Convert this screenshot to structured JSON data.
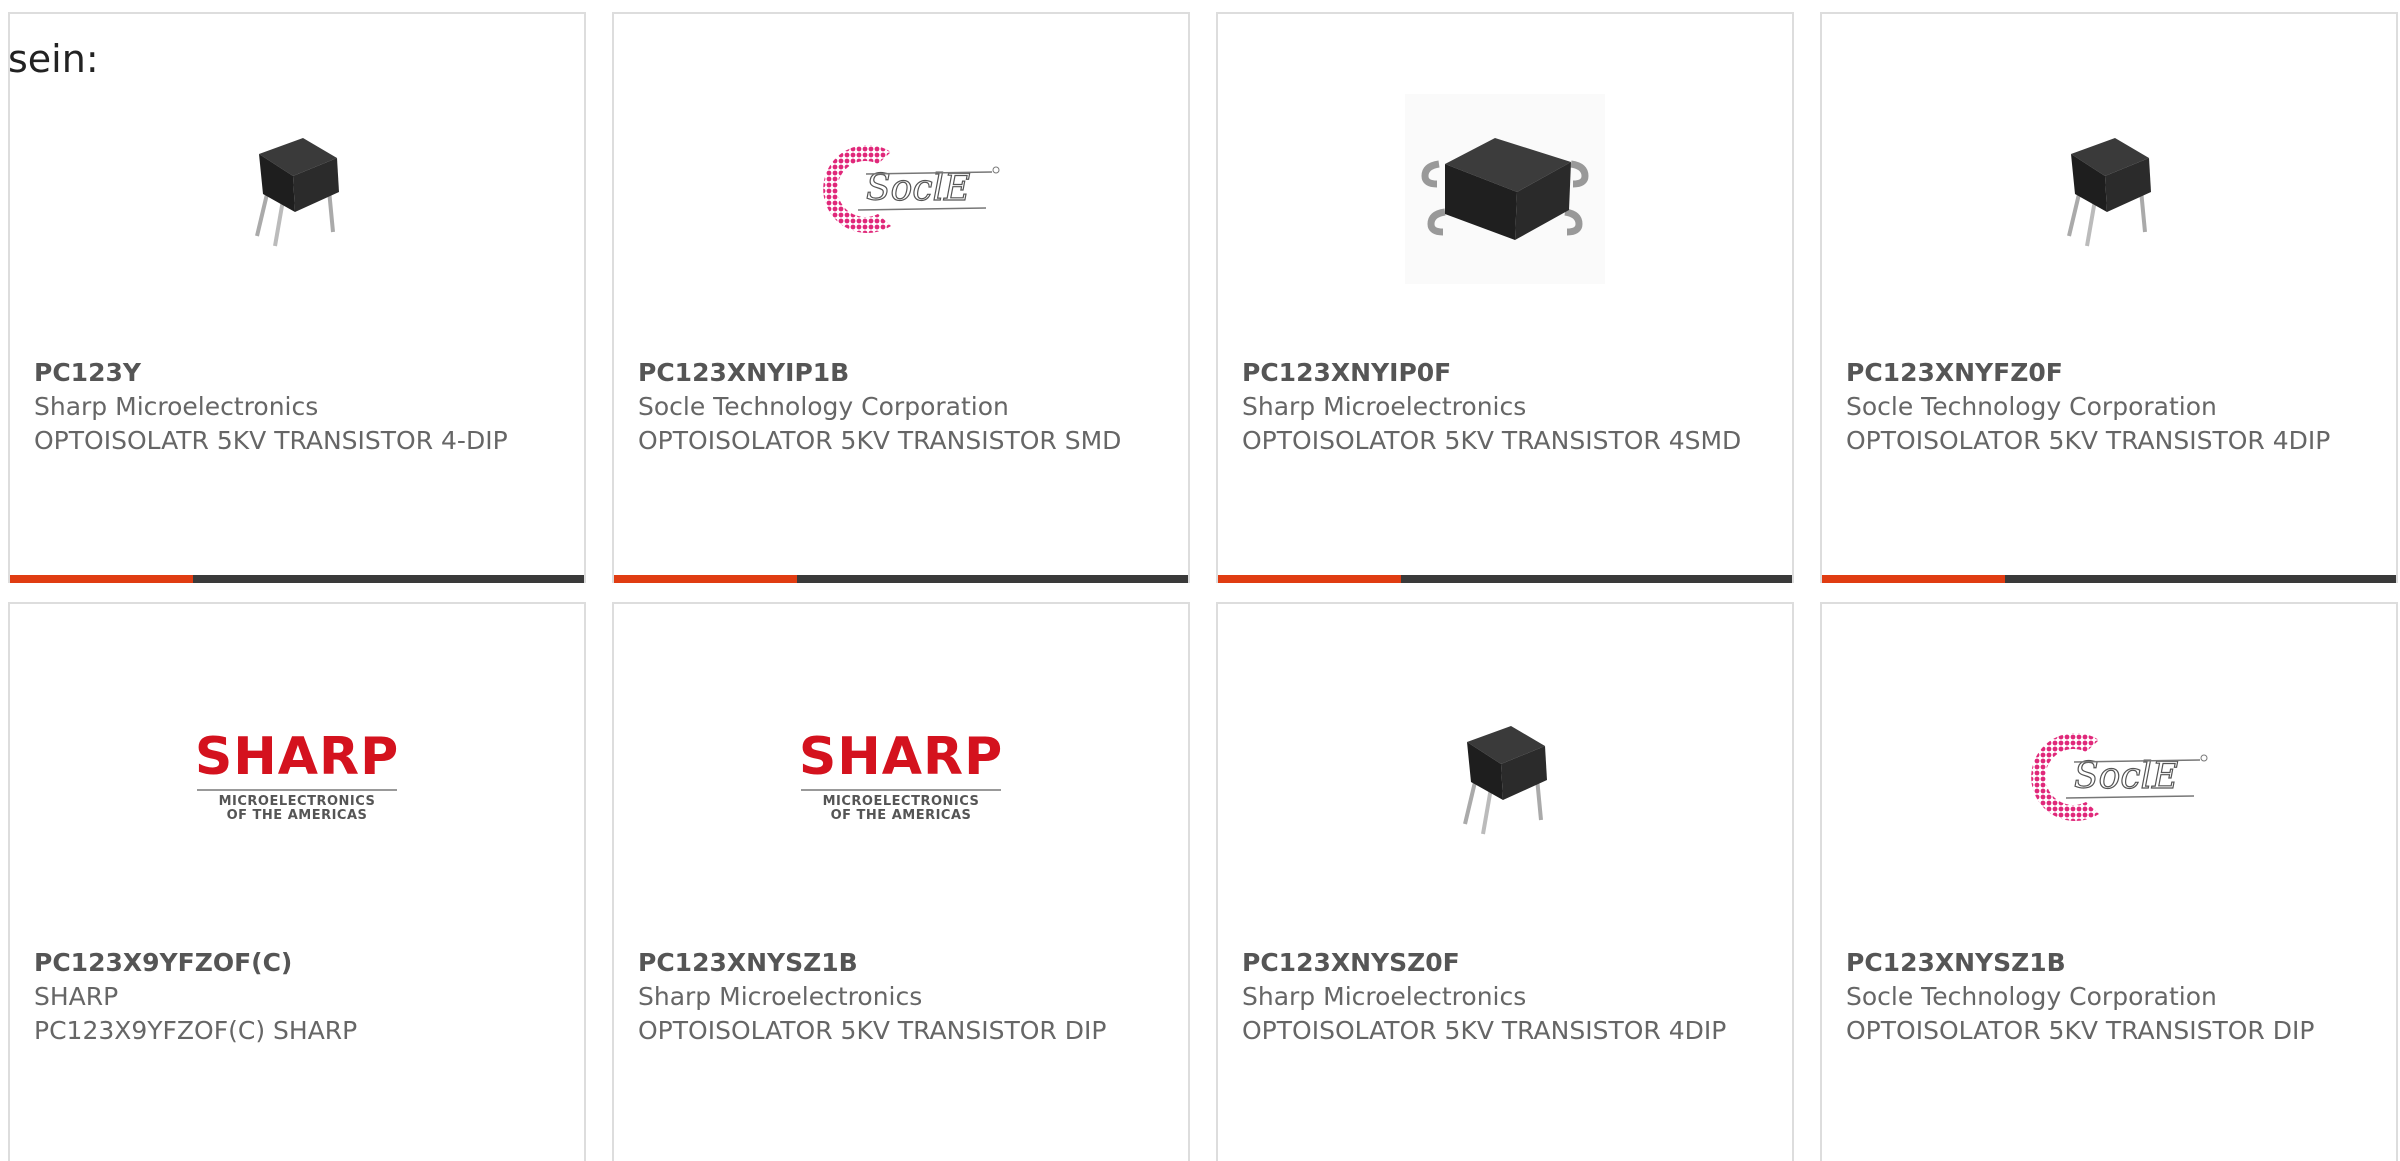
{
  "intro": "sein:",
  "colors": {
    "accent": "#e03c12",
    "bar": "#3a3a3a",
    "sharp_red": "#d4121e",
    "socle_pink": "#e0287a"
  },
  "cards": [
    {
      "part": "PC123Y",
      "manufacturer": "Sharp Microelectronics",
      "description": "OPTOISOLATR 5KV TRANSISTOR 4-DIP",
      "image": "dip-chip-icon"
    },
    {
      "part": "PC123XNYIP1B",
      "manufacturer": "Socle Technology Corporation",
      "description": "OPTOISOLATOR 5KV TRANSISTOR SMD",
      "image": "socle-logo"
    },
    {
      "part": "PC123XNYIP0F",
      "manufacturer": "Sharp Microelectronics",
      "description": "OPTOISOLATOR 5KV TRANSISTOR 4SMD",
      "image": "smd-chip-icon"
    },
    {
      "part": "PC123XNYFZ0F",
      "manufacturer": "Socle Technology Corporation",
      "description": "OPTOISOLATOR 5KV TRANSISTOR 4DIP",
      "image": "dip-chip-icon"
    },
    {
      "part": "PC123X9YFZOF(C)",
      "manufacturer": "SHARP",
      "description": "PC123X9YFZOF(C) SHARP",
      "image": "sharp-logo"
    },
    {
      "part": "PC123XNYSZ1B",
      "manufacturer": "Sharp Microelectronics",
      "description": "OPTOISOLATOR 5KV TRANSISTOR DIP",
      "image": "sharp-logo"
    },
    {
      "part": "PC123XNYSZ0F",
      "manufacturer": "Sharp Microelectronics",
      "description": "OPTOISOLATOR 5KV TRANSISTOR 4DIP",
      "image": "dip-chip-icon"
    },
    {
      "part": "PC123XNYSZ1B",
      "manufacturer": "Socle Technology Corporation",
      "description": "OPTOISOLATOR 5KV TRANSISTOR DIP",
      "image": "socle-logo"
    }
  ],
  "sharp_logo": {
    "name": "SHARP",
    "line1": "MICROELECTRONICS",
    "line2": "OF THE AMERICAS"
  },
  "socle_logo": {
    "text": "SoclE"
  }
}
